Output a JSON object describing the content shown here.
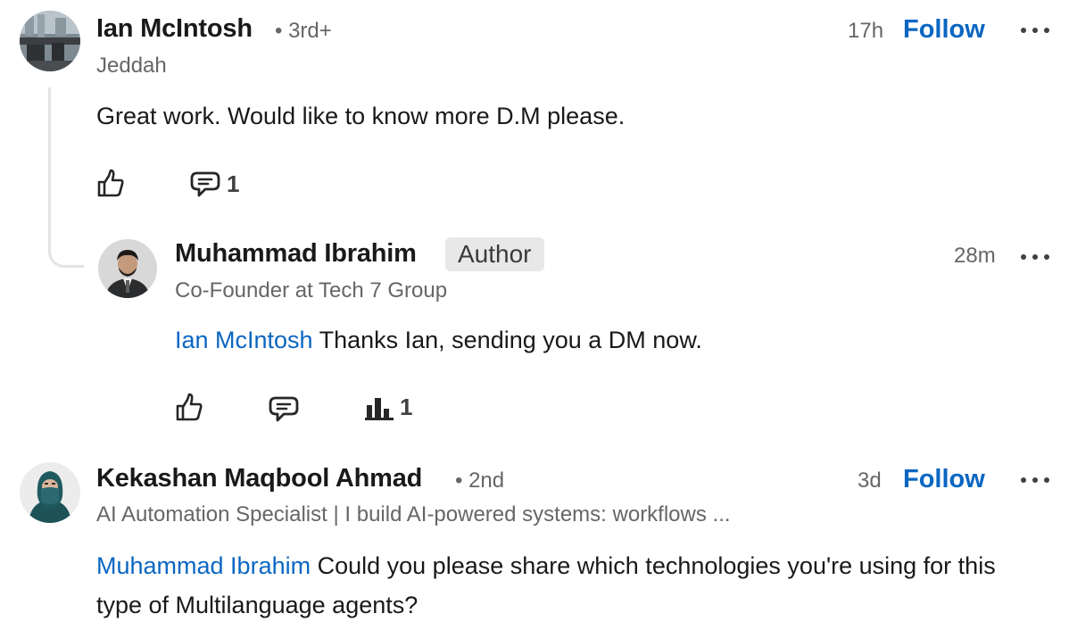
{
  "comments": [
    {
      "author": "Ian McIntosh",
      "degree": "• 3rd+",
      "subtitle": "Jeddah",
      "time": "17h",
      "follow_label": "Follow",
      "text": "Great work. Would like to know more D.M please.",
      "reply_count": "1",
      "reply": {
        "author": "Muhammad Ibrahim",
        "badge": "Author",
        "subtitle": "Co-Founder at Tech 7 Group",
        "time": "28m",
        "mention": "Ian McIntosh",
        "text": " Thanks Ian, sending you a DM now.",
        "impressions_count": "1"
      }
    },
    {
      "author": "Kekashan Maqbool Ahmad",
      "degree": "• 2nd",
      "subtitle": "AI Automation Specialist | I build AI-powered systems: workflows ...",
      "time": "3d",
      "follow_label": "Follow",
      "mention": "Muhammad Ibrahim",
      "text": " Could you please share which technologies you're using for this type of Multilanguage agents?"
    }
  ],
  "colors": {
    "link": "#0a66c2",
    "muted": "#666666",
    "text": "#191919"
  }
}
